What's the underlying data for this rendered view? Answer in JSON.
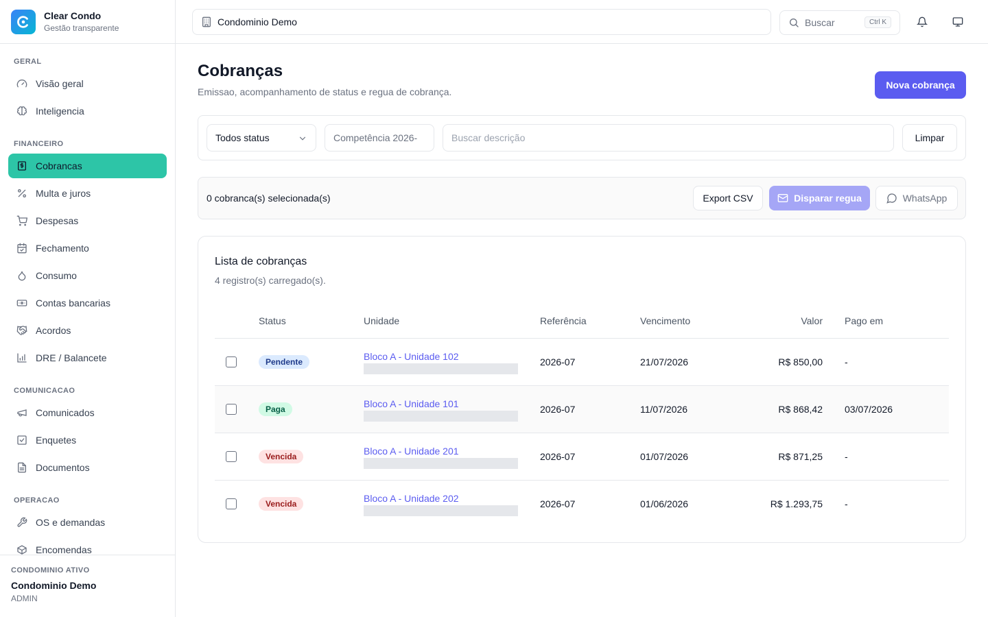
{
  "brand": {
    "name": "Clear Condo",
    "subtitle": "Gestão transparente"
  },
  "nav": {
    "sections": [
      {
        "label": "GERAL",
        "items": [
          {
            "label": "Visão geral",
            "icon": "gauge-icon"
          },
          {
            "label": "Inteligencia",
            "icon": "brain-icon"
          }
        ]
      },
      {
        "label": "FINANCEIRO",
        "items": [
          {
            "label": "Cobrancas",
            "icon": "receipt-icon",
            "active": true
          },
          {
            "label": "Multa e juros",
            "icon": "percent-icon"
          },
          {
            "label": "Despesas",
            "icon": "cart-icon"
          },
          {
            "label": "Fechamento",
            "icon": "calendar-check-icon"
          },
          {
            "label": "Consumo",
            "icon": "droplet-icon"
          },
          {
            "label": "Contas bancarias",
            "icon": "banknote-icon"
          },
          {
            "label": "Acordos",
            "icon": "handshake-icon"
          },
          {
            "label": "DRE / Balancete",
            "icon": "bar-chart-icon"
          }
        ]
      },
      {
        "label": "COMUNICACAO",
        "items": [
          {
            "label": "Comunicados",
            "icon": "megaphone-icon"
          },
          {
            "label": "Enquetes",
            "icon": "poll-icon"
          },
          {
            "label": "Documentos",
            "icon": "file-icon"
          }
        ]
      },
      {
        "label": "OPERACAO",
        "items": [
          {
            "label": "OS e demandas",
            "icon": "wrench-icon"
          },
          {
            "label": "Encomendas",
            "icon": "package-icon"
          }
        ]
      }
    ]
  },
  "sidebar_footer": {
    "label": "CONDOMINIO ATIVO",
    "name": "Condominio Demo",
    "role": "ADMIN"
  },
  "header": {
    "condo": "Condominio Demo",
    "search_label": "Buscar",
    "search_shortcut": "Ctrl K"
  },
  "page": {
    "title": "Cobranças",
    "subtitle": "Emissao, acompanhamento de status e regua de cobrança.",
    "primary_action": "Nova cobrança"
  },
  "filters": {
    "status_value": "Todos status",
    "competencia_value": "Competência 2026-",
    "search_placeholder": "Buscar descrição",
    "clear_label": "Limpar"
  },
  "selection": {
    "text": "0 cobranca(s) selecionada(s)",
    "export_label": "Export CSV",
    "regua_label": "Disparar regua",
    "whatsapp_label": "WhatsApp"
  },
  "list": {
    "title": "Lista de cobranças",
    "subtitle": "4 registro(s) carregado(s).",
    "columns": [
      "Status",
      "Unidade",
      "Referência",
      "Vencimento",
      "Valor",
      "Pago em"
    ],
    "rows": [
      {
        "status": "Pendente",
        "status_kind": "pendente",
        "unit": "Bloco A - Unidade 102",
        "ref": "2026-07",
        "due": "21/07/2026",
        "value": "R$ 850,00",
        "paid": "-"
      },
      {
        "status": "Paga",
        "status_kind": "paga",
        "unit": "Bloco A - Unidade 101",
        "ref": "2026-07",
        "due": "11/07/2026",
        "value": "R$ 868,42",
        "paid": "03/07/2026"
      },
      {
        "status": "Vencida",
        "status_kind": "vencida",
        "unit": "Bloco A - Unidade 201",
        "ref": "2026-07",
        "due": "01/07/2026",
        "value": "R$ 871,25",
        "paid": "-"
      },
      {
        "status": "Vencida",
        "status_kind": "vencida",
        "unit": "Bloco A - Unidade 202",
        "ref": "2026-07",
        "due": "01/06/2026",
        "value": "R$ 1.293,75",
        "paid": "-"
      }
    ]
  },
  "colors": {
    "accent": "#5b5cf0",
    "active_nav": "#2dc5a7",
    "disabled_accent": "#a5a6f6"
  }
}
